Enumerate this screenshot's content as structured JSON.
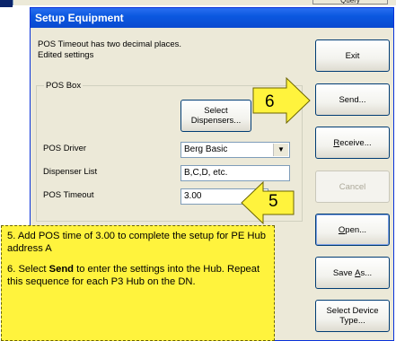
{
  "background": {
    "query_label": "Query"
  },
  "dialog": {
    "title": "Setup Equipment",
    "info_line1": "POS Timeout has two decimal places.",
    "info_line2": "Edited settings"
  },
  "pos_box": {
    "legend": "POS Box",
    "select_dispensers_line1": "Select",
    "select_dispensers_line2": "Dispensers...",
    "pos_driver_label": "POS Driver",
    "pos_driver_value": "Berg Basic",
    "dispenser_list_label": "Dispenser List",
    "dispenser_list_value": "B,C,D, etc.",
    "pos_timeout_label": "POS Timeout",
    "pos_timeout_value": "3.00"
  },
  "buttons": {
    "exit": "Exit",
    "send": "Send...",
    "receive_mnemonic": "R",
    "receive_rest": "eceive...",
    "cancel": "Cancel",
    "open_mnemonic": "O",
    "open_rest": "pen...",
    "save_as_prefix": "Save ",
    "save_as_mnemonic": "A",
    "save_as_rest": "s...",
    "select_device_type_line1": "Select Device",
    "select_device_type_line2": "Type..."
  },
  "callouts": {
    "step6": "6",
    "step5": "5"
  },
  "note": {
    "step5_text": "5. Add POS time of 3.00 to complete the setup for PE Hub address A",
    "step6_prefix": "6. Select ",
    "step6_bold": "Send",
    "step6_suffix": " to enter the settings into the Hub. Repeat this sequence for each P3 Hub on the DN."
  },
  "colors": {
    "titlebar": "#0b58e0",
    "dialog_bg": "#ece9d8",
    "callout_yellow": "#fff33d"
  }
}
